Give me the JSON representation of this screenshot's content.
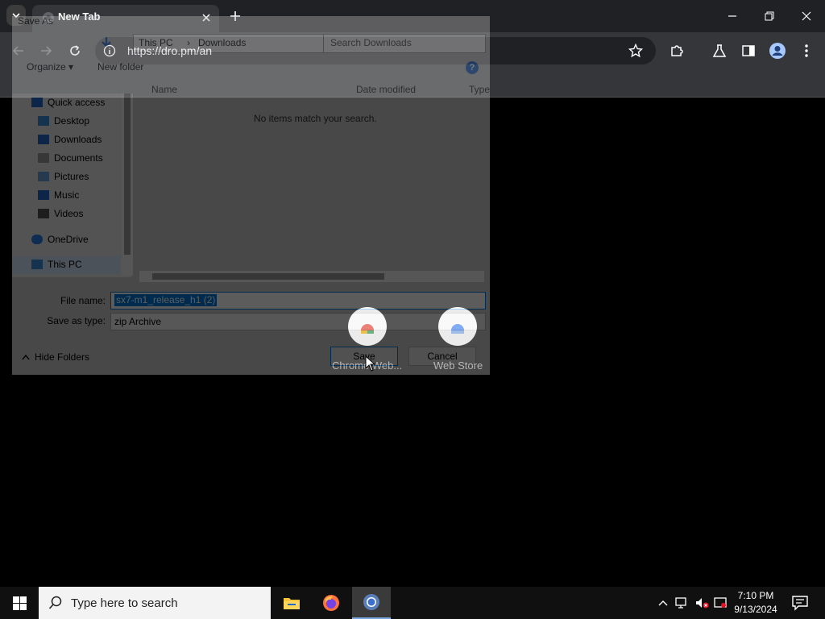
{
  "browser": {
    "tab_title": "New Tab",
    "url": "https://dro.pm/an",
    "colors": {
      "tab_active": "#35363a",
      "toolbar": "#35363a",
      "omnibox": "#202124"
    },
    "shortcuts": [
      {
        "label": "Chrome Web...",
        "icon": "chrome-web-store-icon"
      },
      {
        "label": "Web Store",
        "icon": "web-store-icon"
      }
    ]
  },
  "dialog": {
    "title": "Save As",
    "breadcrumb": [
      "This PC",
      "Downloads"
    ],
    "search_placeholder": "Search Downloads",
    "organize_label": "Organize ▾",
    "new_folder_label": "New folder",
    "columns": [
      "Name",
      "Date modified",
      "Type"
    ],
    "empty_message": "No items match your search.",
    "nav_items": [
      {
        "label": "Quick access",
        "icon": "star-icon"
      },
      {
        "label": "Desktop",
        "icon": "desktop-icon"
      },
      {
        "label": "Downloads",
        "icon": "download-icon"
      },
      {
        "label": "Documents",
        "icon": "document-icon"
      },
      {
        "label": "Pictures",
        "icon": "picture-icon"
      },
      {
        "label": "Music",
        "icon": "music-icon"
      },
      {
        "label": "Videos",
        "icon": "video-icon"
      },
      {
        "label": "OneDrive",
        "icon": "cloud-icon"
      },
      {
        "label": "This PC",
        "icon": "computer-icon"
      }
    ],
    "file_name_label": "File name:",
    "file_name_value": "sx7-m1_release_h1 (2)",
    "save_type_label": "Save as type:",
    "save_type_value": "zip Archive",
    "hide_folders_label": "Hide Folders",
    "save_label": "Save",
    "cancel_label": "Cancel"
  },
  "taskbar": {
    "search_placeholder": "Type here to search",
    "time": "7:10 PM",
    "date": "9/13/2024",
    "apps": [
      "file-explorer-icon",
      "firefox-icon",
      "chrome-icon"
    ]
  }
}
